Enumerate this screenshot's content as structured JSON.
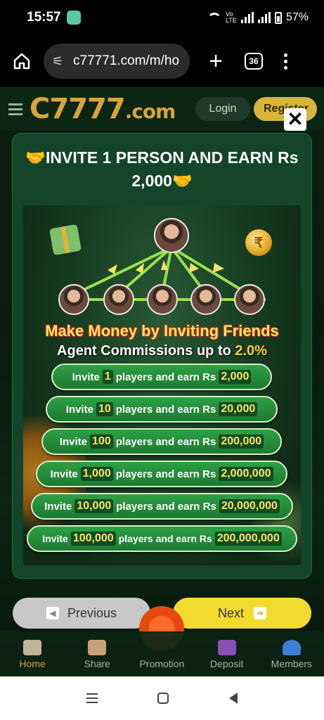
{
  "status_bar": {
    "time": "15:57",
    "network": "Vo LTE",
    "battery": "57%"
  },
  "browser": {
    "url": "c77771.com/m/ho",
    "tabs_count": "36"
  },
  "site": {
    "logo": "C7777",
    "logo_suffix": ".com",
    "login_label": "Login",
    "register_label": "Register"
  },
  "modal": {
    "title": "🤝INVITE 1 PERSON AND EARN Rs 2,000🤝",
    "close_symbol": "✕",
    "coin_symbol": "₹",
    "headline": "Make Money by Inviting Friends",
    "subline_prefix": "Agent Commissions up to ",
    "subline_pct": "2.0%",
    "rewards": [
      {
        "prefix": "Invite",
        "players": "1",
        "middle": "players and earn Rs",
        "amount": "2,000"
      },
      {
        "prefix": "Invite",
        "players": "10",
        "middle": "players and earn Rs",
        "amount": "20,000"
      },
      {
        "prefix": "Invite",
        "players": "100",
        "middle": "players and earn Rs",
        "amount": "200,000"
      },
      {
        "prefix": "Invite",
        "players": "1,000",
        "middle": "players and earn Rs",
        "amount": "2,000,000"
      },
      {
        "prefix": "Invite",
        "players": "10,000",
        "middle": "players and earn Rs",
        "amount": "20,000,000"
      },
      {
        "prefix": "Invite",
        "players": "100,000",
        "middle": "players and earn Rs",
        "amount": "200,000,000"
      }
    ]
  },
  "pager": {
    "previous_label": "Previous",
    "next_label": "Next"
  },
  "tabs": [
    {
      "label": "Home",
      "icon": "home-icon",
      "active": true
    },
    {
      "label": "Share",
      "icon": "share-icon",
      "active": false
    },
    {
      "label": "Promotion",
      "icon": "gift-icon",
      "active": false
    },
    {
      "label": "Deposit",
      "icon": "wallet-icon",
      "active": false
    },
    {
      "label": "Members",
      "icon": "user-icon",
      "active": false
    }
  ],
  "colors": {
    "accent": "#d9a43a",
    "modal_bg": "#14452a",
    "next_button": "#f3da2e",
    "reward_green": "#2ea045"
  }
}
